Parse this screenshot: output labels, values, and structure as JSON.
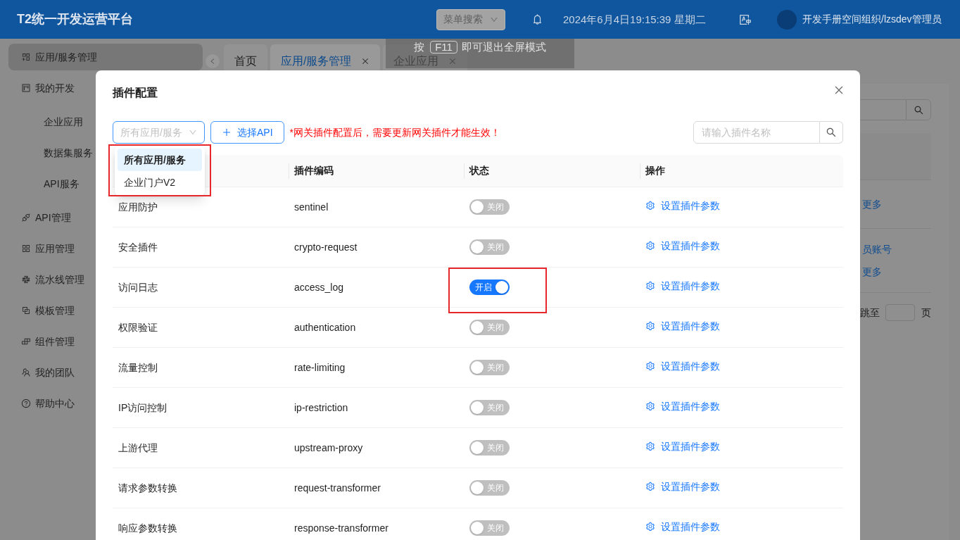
{
  "header": {
    "title": "T2统一开发运营平台",
    "menu_search": {
      "placeholder": "菜单搜索"
    },
    "datetime": "2024年6月4日19:15:39 星期二",
    "user": "开发手册空间组织/lzsdev管理员"
  },
  "sidebar": {
    "items": [
      {
        "label": "应用/服务管理",
        "selected": true
      },
      {
        "label": "我的开发",
        "selected": false,
        "children": [
          {
            "label": "企业应用",
            "selected": false
          },
          {
            "label": "数据集服务",
            "selected": false
          },
          {
            "label": "API服务",
            "selected": false
          }
        ]
      },
      {
        "label": "API管理",
        "selected": false
      },
      {
        "label": "应用管理",
        "selected": false
      },
      {
        "label": "流水线管理",
        "selected": false
      },
      {
        "label": "模板管理",
        "selected": false
      },
      {
        "label": "组件管理",
        "selected": false
      },
      {
        "label": "我的团队",
        "selected": false
      },
      {
        "label": "帮助中心",
        "selected": false
      }
    ]
  },
  "tabs": [
    {
      "label": "首页",
      "selected": false,
      "closable": false
    },
    {
      "label": "应用/服务管理",
      "selected": true,
      "closable": true
    },
    {
      "label": "企业应用",
      "selected": false,
      "closable": true
    }
  ],
  "fullscreen_hint": {
    "prefix": "按",
    "key": "F11",
    "suffix": "即可退出全屏模式"
  },
  "background_list": {
    "rows": [
      {
        "links": [
          "更多"
        ]
      },
      {
        "links": [
          "员账号",
          "更多"
        ]
      }
    ],
    "pager": {
      "jump_label": "跳至",
      "unit": "页"
    }
  },
  "dialog": {
    "title": "插件配置",
    "app_select": {
      "placeholder": "所有应用/服务",
      "open": true,
      "highlighted": true,
      "options": [
        {
          "label": "所有应用/服务",
          "selected": true
        },
        {
          "label": "企业门户V2",
          "selected": false
        }
      ]
    },
    "select_api_button": "选择API",
    "notice": "*网关插件配置后，需要更新网关插件才能生效！",
    "search": {
      "placeholder": "请输入插件名称"
    },
    "table": {
      "columns": [
        "插件编码",
        "状态",
        "操作"
      ],
      "rows": [
        {
          "name": "应用防护",
          "code": "sentinel",
          "on": false,
          "status": "关闭",
          "action": "设置插件参数",
          "highlighted": false
        },
        {
          "name": "安全插件",
          "code": "crypto-request",
          "on": false,
          "status": "关闭",
          "action": "设置插件参数",
          "highlighted": false
        },
        {
          "name": "访问日志",
          "code": "access_log",
          "on": true,
          "status": "开启",
          "action": "设置插件参数",
          "highlighted": true
        },
        {
          "name": "权限验证",
          "code": "authentication",
          "on": false,
          "status": "关闭",
          "action": "设置插件参数",
          "highlighted": false
        },
        {
          "name": "流量控制",
          "code": "rate-limiting",
          "on": false,
          "status": "关闭",
          "action": "设置插件参数",
          "highlighted": false
        },
        {
          "name": "IP访问控制",
          "code": "ip-restriction",
          "on": false,
          "status": "关闭",
          "action": "设置插件参数",
          "highlighted": false
        },
        {
          "name": "上游代理",
          "code": "upstream-proxy",
          "on": false,
          "status": "关闭",
          "action": "设置插件参数",
          "highlighted": false
        },
        {
          "name": "请求参数转换",
          "code": "request-transformer",
          "on": false,
          "status": "关闭",
          "action": "设置插件参数",
          "highlighted": false
        },
        {
          "name": "响应参数转换",
          "code": "response-transformer",
          "on": false,
          "status": "关闭",
          "action": "设置插件参数",
          "highlighted": false
        }
      ]
    }
  }
}
